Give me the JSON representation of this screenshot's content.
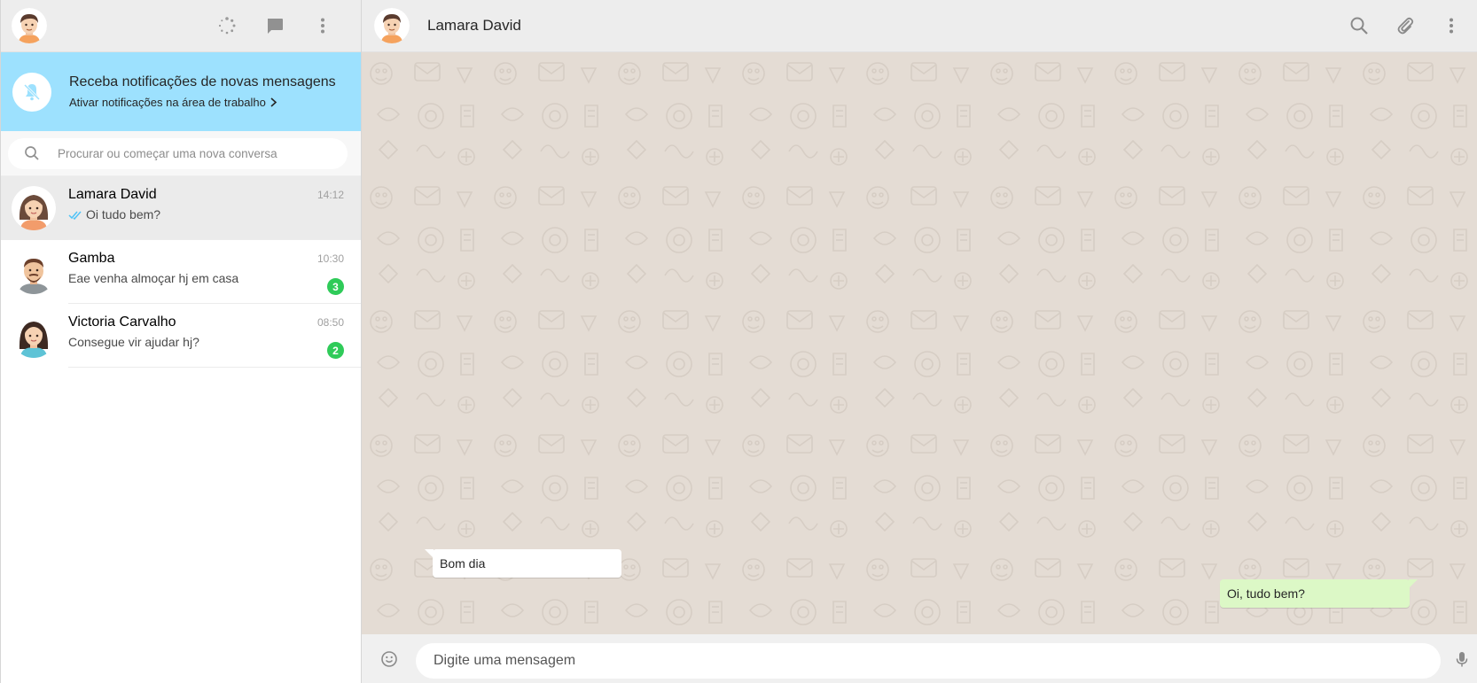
{
  "sidebar": {
    "header": {
      "user_avatar": "avatar-male-icon",
      "actions": [
        "status-icon",
        "new-chat-icon",
        "menu-icon"
      ]
    },
    "notification": {
      "title": "Receba notificações de novas mensagens",
      "link": "Ativar notificações na área de trabalho",
      "icon": "bell-off-icon"
    },
    "search": {
      "placeholder": "Procurar ou começar uma nova conversa"
    },
    "chats": [
      {
        "name": "Lamara David",
        "preview": "Oi tudo bem?",
        "time": "14:12",
        "read_ticks": true,
        "unread": "",
        "active": true
      },
      {
        "name": "Gamba",
        "preview": "Eae venha almoçar hj em casa",
        "time": "10:30",
        "unread": "3",
        "active": false
      },
      {
        "name": "Victoria Carvalho",
        "preview": "Consegue vir ajudar hj?",
        "time": "08:50",
        "unread": "2",
        "active": false
      }
    ]
  },
  "main": {
    "header": {
      "contact_name": "Lamara David",
      "actions": [
        "search-icon",
        "attach-icon",
        "menu-icon"
      ]
    },
    "messages": [
      {
        "direction": "in",
        "text": "Bom dia"
      },
      {
        "direction": "out",
        "text": "Oi, tudo bem?"
      }
    ],
    "composer": {
      "placeholder": "Digite uma mensagem"
    }
  },
  "colors": {
    "header_bg": "#ededed",
    "notification_bg": "#9de1fe",
    "conversation_bg": "#e4dcd4",
    "outgoing_bubble": "#dcf8c6",
    "incoming_bubble": "#ffffff",
    "badge": "#2fcb59",
    "read_tick": "#4fc3f7"
  }
}
